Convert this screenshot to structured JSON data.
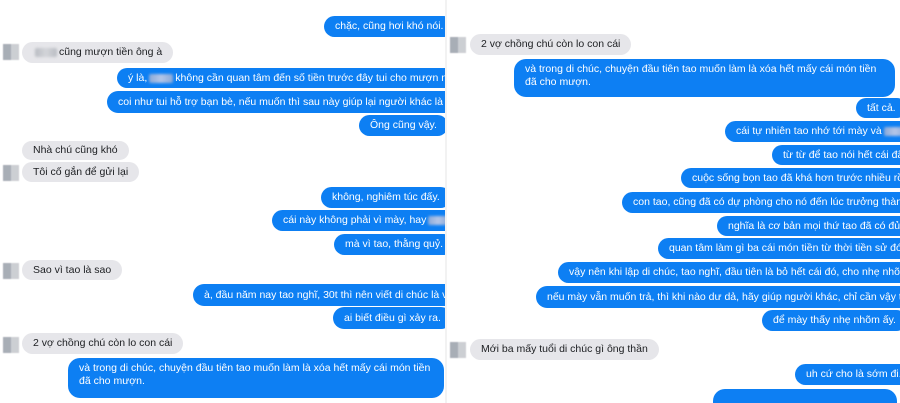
{
  "left": {
    "msg1": "chặc, cũng hơi khó nói.",
    "msg2_suffix": "cũng mượn tiền ông à",
    "msg3_prefix": "ý là,",
    "msg3_suffix": "không cần quan tâm đến số tiền trước đây tui cho mượn nữa.",
    "msg4": "coi như tui hỗ trợ bạn bè, nếu muốn thì sau này giúp lại người khác là được.",
    "msg5": "Ông cũng vậy.",
    "msg6": "Nhà chú cũng khó",
    "msg7": "Tôi cố gắn để gửi lại",
    "msg8": "không, nghiêm túc đấy.",
    "msg9_prefix": "cái này không phải vì mày, hay",
    "msg10": "mà vì tao, thằng quỷ.",
    "msg11": "Sao vì tao là sao",
    "msg12": "à, đầu năm nay tao nghĩ, 30t thì nên viết di chúc là vừa.",
    "msg13": "ai biết điều gì xảy ra.",
    "msg14": "2 vợ chồng chú còn lo con cái",
    "msg15": "và trong di chúc, chuyện đầu tiên tao muốn làm là xóa hết mấy cái món tiền đã cho mượn."
  },
  "right": {
    "msg1": "2 vợ chồng chú còn lo con cái",
    "msg2": "và trong di chúc, chuyện đầu tiên tao muốn làm là xóa hết mấy cái món tiền đã cho mượn.",
    "msg3": "tất cả.",
    "msg4_prefix": "cái tự nhiên tao nhớ tới mày và",
    "msg5": "từ từ để tao nói hết cái đã",
    "msg6": "cuộc sống bọn tao đã khá hơn trước nhiều rồi.",
    "msg7": "con tao, cũng đã có dự phòng cho nó đến lúc trưởng thành.",
    "msg8": "nghĩa là cơ bản mọi thứ tao đã có đủ.",
    "msg9": "quan tâm làm gì ba cái món tiền từ thời tiền sử đó.",
    "msg10": "vậy nên khi lập di chúc, tao nghĩ, đầu tiên là bỏ hết cái đó, cho nhẹ nhõm.",
    "msg11": "nếu mày vẫn muốn trả, thì khi nào dư dả, hãy giúp người khác, chỉ cần vậy thôi.",
    "msg12": "để mày thấy nhẹ nhõm ấy.",
    "msg13": "Mới ba mấy tuổi di chúc gì ông thần",
    "msg14": "uh cứ cho là sớm đi."
  },
  "colors": {
    "outgoing": "#0d7ff3",
    "incoming": "#e6e6ea"
  }
}
